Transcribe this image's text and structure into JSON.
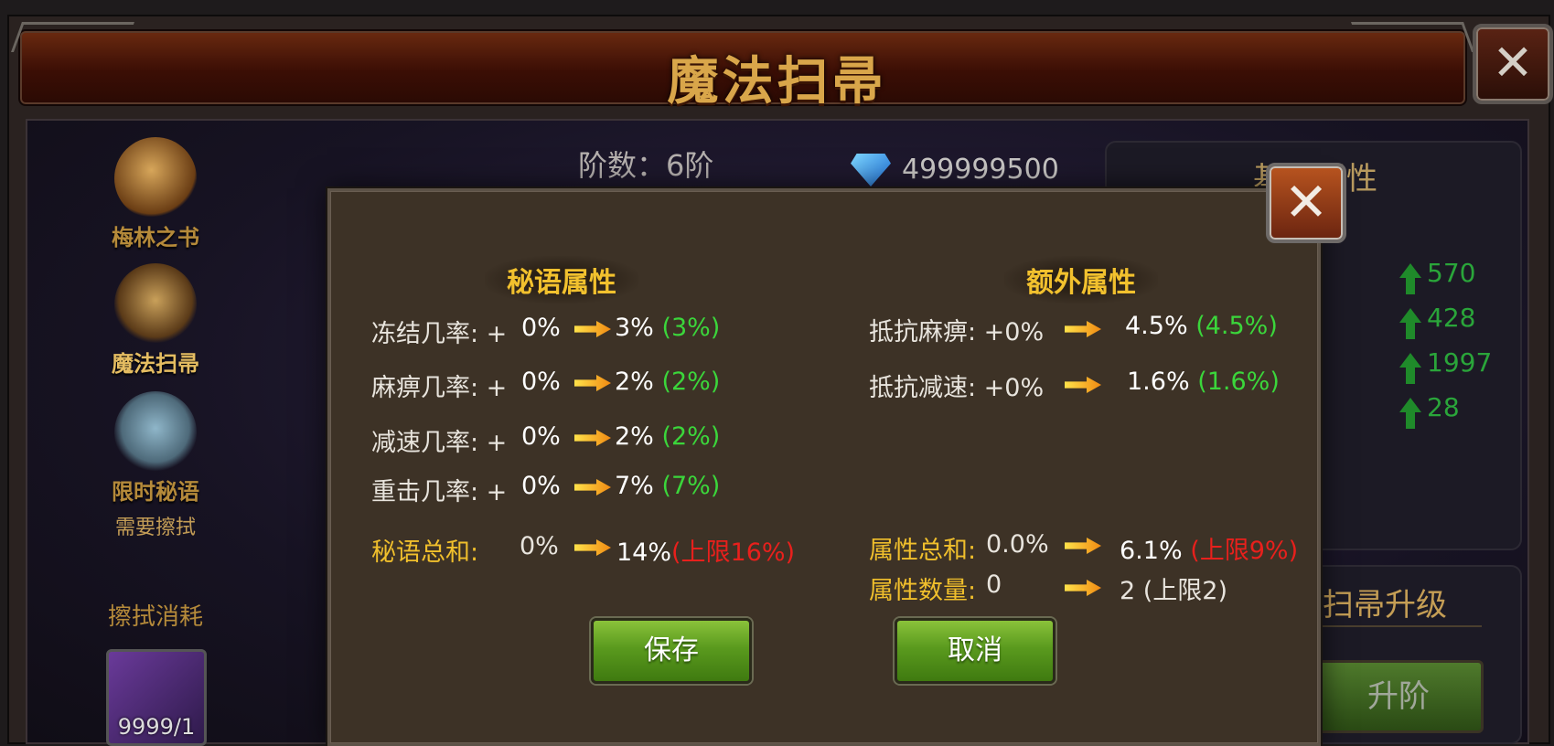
{
  "window": {
    "title": "魔法扫帚"
  },
  "sidebar": {
    "items": [
      {
        "label": "梅林之书",
        "icon": "book-icon"
      },
      {
        "label": "魔法扫帚",
        "icon": "broom-icon"
      },
      {
        "label": "限时秘语",
        "sub": "需要擦拭",
        "icon": "feather-broom-icon"
      }
    ],
    "cost_label": "擦拭消耗",
    "cost_count": "9999/1"
  },
  "header": {
    "stage": "阶数：6阶",
    "gems": "499999500"
  },
  "right_panel": {
    "title": "基础属性",
    "stats": [
      "570",
      "428",
      "1997",
      "28"
    ],
    "upgrade_title": "扫帚升级",
    "upgrade_button": "升阶"
  },
  "dialog": {
    "left_header": "秘语属性",
    "right_header": "额外属性",
    "left_rows": [
      {
        "label": "冻结几率: +",
        "from": "0%",
        "to": "3%",
        "bonus": "(3%)"
      },
      {
        "label": "麻痹几率: +",
        "from": "0%",
        "to": "2%",
        "bonus": "(2%)"
      },
      {
        "label": "减速几率: +",
        "from": "0%",
        "to": "2%",
        "bonus": "(2%)"
      },
      {
        "label": "重击几率: +",
        "from": "0%",
        "to": "7%",
        "bonus": "(7%)"
      }
    ],
    "left_total": {
      "label": "秘语总和:",
      "from": "0%",
      "to": "14%",
      "limit": "(上限16%)"
    },
    "right_rows": [
      {
        "label": "抵抗麻痹: +0%",
        "to": "4.5%",
        "bonus": "(4.5%)"
      },
      {
        "label": "抵抗减速: +0%",
        "to": "1.6%",
        "bonus": "(1.6%)"
      }
    ],
    "right_total": {
      "label": "属性总和:",
      "from": "0.0%",
      "to": "6.1%",
      "limit": "(上限9%)"
    },
    "right_count": {
      "label": "属性数量:",
      "from": "0",
      "to": "2 (上限2)"
    },
    "save_button": "保存",
    "cancel_button": "取消"
  },
  "colors": {
    "gold": "#f0bf2c",
    "green": "#3bd63b",
    "red": "#e8201c",
    "button_green": "#5a9a1e"
  }
}
